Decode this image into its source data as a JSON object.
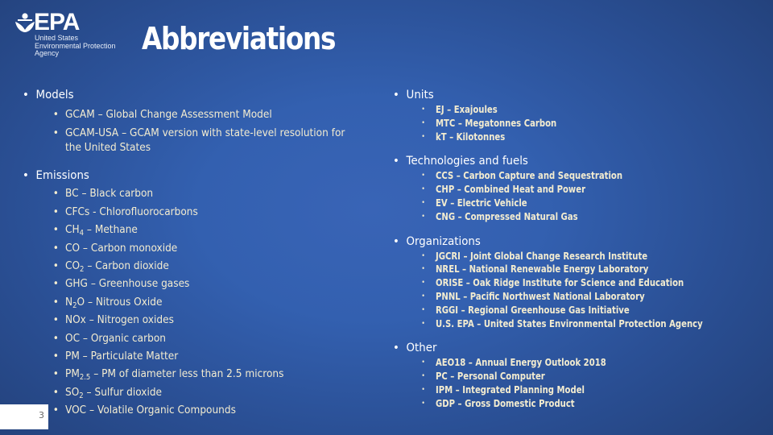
{
  "logo": {
    "name": "EPA",
    "subtitle_lines": [
      "United States",
      "Environmental Protection",
      "Agency"
    ]
  },
  "title": "Abbreviations",
  "page_number": "3",
  "colors": {
    "background_center": "#3964b6",
    "background_edge": "#213d73",
    "heading_text": "#ffffff",
    "item_text": "#f3ecd0"
  },
  "sections": {
    "models": {
      "heading": "Models",
      "items": [
        {
          "abbr": "GCAM",
          "sep": " – ",
          "desc": "Global Change Assessment Model"
        },
        {
          "abbr": "GCAM-USA",
          "sep": " – ",
          "desc": "GCAM version with state-level resolution for the United States"
        }
      ]
    },
    "emissions": {
      "heading": "Emissions",
      "items": [
        {
          "abbr": "BC",
          "sub": "",
          "sep": " – ",
          "desc": "Black carbon"
        },
        {
          "abbr": "CFCs",
          "sub": "",
          "sep": " - ",
          "desc": "Chlorofluorocarbons"
        },
        {
          "abbr": "CH",
          "sub": "4",
          "sep": " – ",
          "desc": "Methane"
        },
        {
          "abbr": "CO",
          "sub": "",
          "sep": " – ",
          "desc": "Carbon monoxide"
        },
        {
          "abbr": "CO",
          "sub": "2",
          "sep": " – ",
          "desc": "Carbon dioxide"
        },
        {
          "abbr": "GHG",
          "sub": "",
          "sep": " – ",
          "desc": "Greenhouse gases"
        },
        {
          "abbr": "N",
          "sub": "2",
          "abbr_tail": "O",
          "sep": " – ",
          "desc": "Nitrous Oxide"
        },
        {
          "abbr": "NOx",
          "sub": "",
          "sep": " – ",
          "desc": "Nitrogen oxides"
        },
        {
          "abbr": "OC",
          "sub": "",
          "sep": " – ",
          "desc": "Organic carbon"
        },
        {
          "abbr": "PM",
          "sub": "",
          "sep": " – ",
          "desc": "Particulate Matter"
        },
        {
          "abbr": "PM",
          "sub": "2.5",
          "sep": " – ",
          "desc": "PM of diameter less than 2.5 microns"
        },
        {
          "abbr": "SO",
          "sub": "2",
          "sep": " – ",
          "desc": "Sulfur dioxide"
        },
        {
          "abbr": "VOC",
          "sub": "",
          "sep": " – ",
          "desc": "Volatile Organic Compounds"
        }
      ]
    },
    "units": {
      "heading": "Units",
      "items": [
        {
          "text": "EJ – Exajoules"
        },
        {
          "text": "MTC – Megatonnes Carbon"
        },
        {
          "text": "kT – Kilotonnes"
        }
      ]
    },
    "technologies": {
      "heading": "Technologies and fuels",
      "items": [
        {
          "text": "CCS – Carbon Capture and Sequestration"
        },
        {
          "text": "CHP – Combined Heat and Power"
        },
        {
          "text": "EV – Electric Vehicle"
        },
        {
          "text": "CNG – Compressed Natural Gas"
        }
      ]
    },
    "organizations": {
      "heading": "Organizations",
      "items": [
        {
          "text": "JGCRI – Joint Global Change Research Institute"
        },
        {
          "text": "NREL – National Renewable Energy Laboratory"
        },
        {
          "text": "ORISE – Oak Ridge Institute for Science and Education"
        },
        {
          "text": "PNNL – Pacific Northwest National Laboratory"
        },
        {
          "text": "RGGI – Regional Greenhouse Gas Initiative"
        },
        {
          "text": "U.S. EPA – United States Environmental Protection Agency"
        }
      ]
    },
    "other": {
      "heading": "Other",
      "items": [
        {
          "text": "AEO18 – Annual Energy Outlook 2018"
        },
        {
          "text": "PC – Personal Computer"
        },
        {
          "text": "IPM – Integrated Planning Model"
        },
        {
          "text": "GDP – Gross Domestic Product"
        }
      ]
    }
  }
}
